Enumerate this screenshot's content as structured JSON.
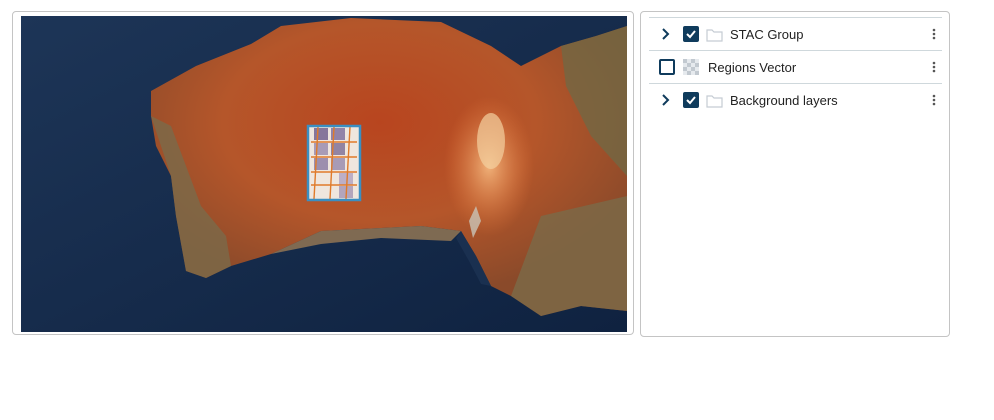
{
  "layers": {
    "items": [
      {
        "label": "STAC Group",
        "checked": true,
        "expandable": true,
        "icon": "folder-icon"
      },
      {
        "label": "Regions Vector",
        "checked": false,
        "expandable": false,
        "icon": "checkerboard-icon"
      },
      {
        "label": "Background layers",
        "checked": true,
        "expandable": true,
        "icon": "folder-icon"
      }
    ]
  },
  "colors": {
    "checkbox": "#0f3b5c",
    "ocean": "#152a46",
    "land": "#b6532a",
    "footprint_outline": "#3a8fc2"
  }
}
